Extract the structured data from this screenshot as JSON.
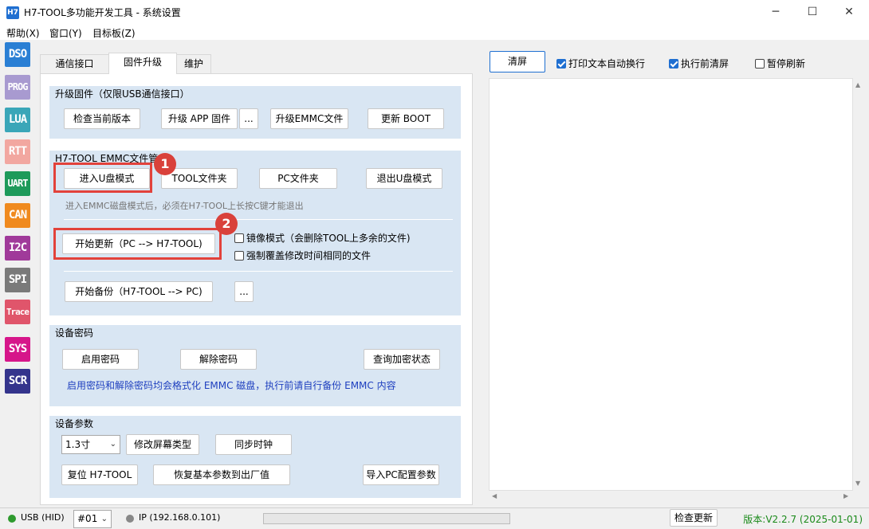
{
  "window": {
    "icon_text": "H7",
    "title": "H7-TOOL多功能开发工具 - 系统设置",
    "min_glyph": "─",
    "max_glyph": "☐",
    "close_glyph": "✕"
  },
  "menu": [
    "帮助(X)",
    "窗口(Y)",
    "目标板(Z)"
  ],
  "sidebar": [
    {
      "label": "DSO",
      "color": "#2a7fd4"
    },
    {
      "label": "PROG",
      "color": "#a89ad0"
    },
    {
      "label": "LUA",
      "color": "#3aa6b8"
    },
    {
      "label": "RTT",
      "color": "#f2a7a0"
    },
    {
      "label": "UART",
      "color": "#1e9a5a"
    },
    {
      "label": "CAN",
      "color": "#f08a1e"
    },
    {
      "label": "I2C",
      "color": "#a03a9a"
    },
    {
      "label": "SPI",
      "color": "#7a7a7a"
    },
    {
      "label": "Trace",
      "color": "#e0556b"
    },
    {
      "label": "SYS",
      "color": "#d6168a"
    },
    {
      "label": "SCR",
      "color": "#34348c"
    }
  ],
  "tabs": [
    "通信接口",
    "固件升级",
    "维护"
  ],
  "upgrade": {
    "title": "升级固件（仅限USB通信接口）",
    "check_version": "检查当前版本",
    "upgrade_app": "升级 APP 固件",
    "more": "...",
    "upgrade_emmc": "升级EMMC文件",
    "update_boot": "更新 BOOT"
  },
  "emmc": {
    "title": "H7-TOOL EMMC文件管",
    "enter_udisk": "进入U盘模式",
    "tool_folder": "TOOL文件夹",
    "pc_folder": "PC文件夹",
    "exit_udisk": "退出U盘模式",
    "hint": "进入EMMC磁盘模式后，必须在H7-TOOL上长按C键才能退出",
    "start_update": "开始更新（PC --> H7-TOOL)",
    "mirror_mode": "镜像模式（会删除TOOL上多余的文件)",
    "force_overwrite": "强制覆盖修改时间相同的文件",
    "start_backup": "开始备份（H7-TOOL --> PC)",
    "more": "...",
    "badge1": "1",
    "badge2": "2"
  },
  "password": {
    "title": "设备密码",
    "enable": "启用密码",
    "disable": "解除密码",
    "query": "查询加密状态",
    "note": "启用密码和解除密码均会格式化 EMMC 磁盘，执行前请自行备份 EMMC 内容"
  },
  "params": {
    "title": "设备参数",
    "screen_size": "1.3寸",
    "change_screen": "修改屏幕类型",
    "sync_clock": "同步时钟",
    "reset": "复位 H7-TOOL",
    "restore": "恢复基本参数到出厂值",
    "import_pc": "导入PC配置参数"
  },
  "log_toolbar": {
    "clear": "清屏",
    "auto_wrap": "打印文本自动换行",
    "clear_before": "执行前清屏",
    "pause_refresh": "暂停刷新"
  },
  "status": {
    "usb_label": "USB (HID)",
    "usb_color": "#2e9a2e",
    "device_id": "#01",
    "ip_label": "IP (192.168.0.101)",
    "ip_color": "#888888",
    "check_update": "检查更新",
    "version": "版本:V2.2.7 (2025-01-01)"
  }
}
